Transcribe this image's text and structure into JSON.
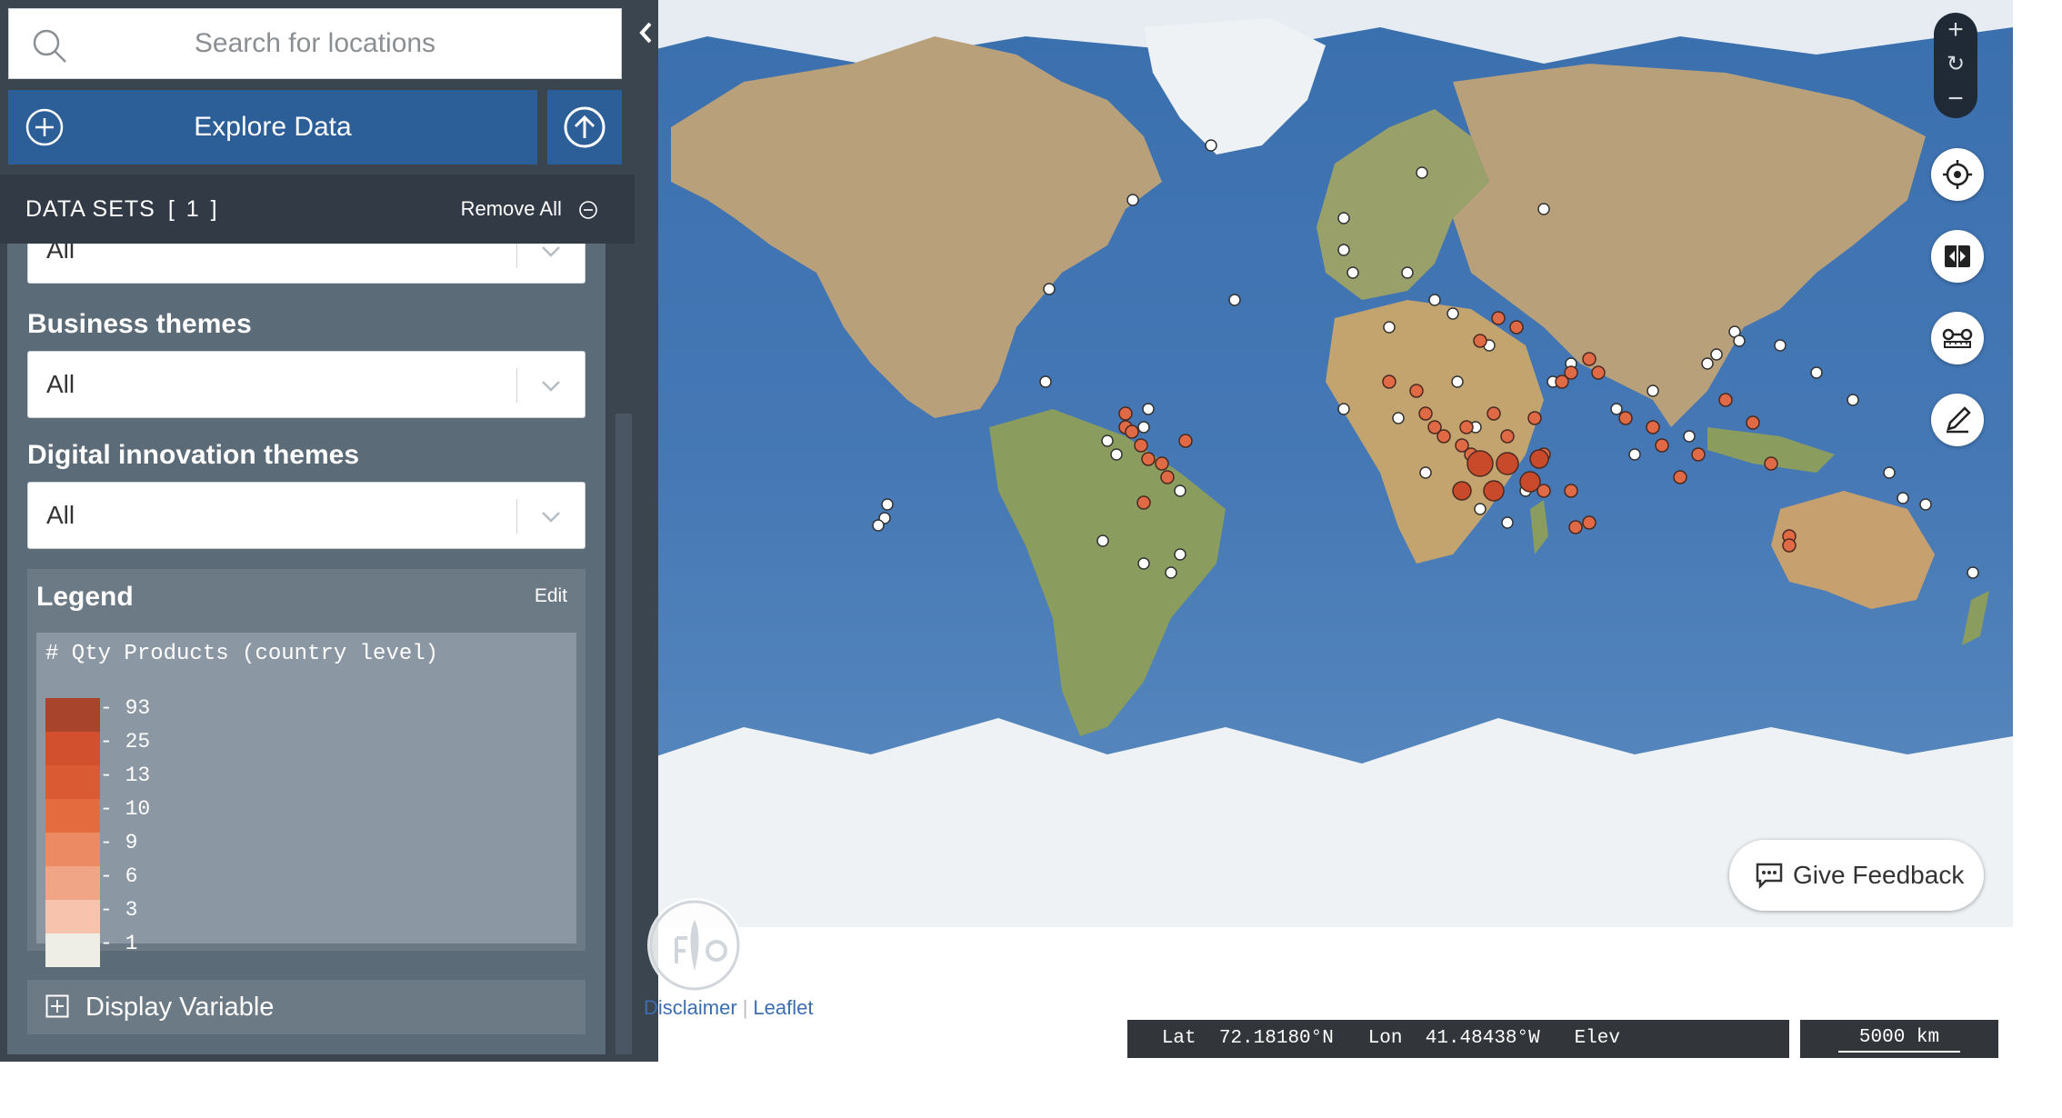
{
  "search": {
    "placeholder": "Search for locations"
  },
  "explore": {
    "label": "Explore Data"
  },
  "datasets": {
    "title": "DATA SETS",
    "count": "[ 1 ]",
    "remove_all": "Remove All"
  },
  "filters": [
    {
      "label": "",
      "value": "All"
    },
    {
      "label": "Business themes",
      "value": "All"
    },
    {
      "label": "Digital innovation themes",
      "value": "All"
    }
  ],
  "legend": {
    "title": "Legend",
    "edit": "Edit",
    "variable": "# Qty Products (country level)",
    "classes": [
      {
        "value": "93",
        "color": "#a8442c"
      },
      {
        "value": "25",
        "color": "#d3502f"
      },
      {
        "value": "13",
        "color": "#d95a33"
      },
      {
        "value": "10",
        "color": "#e36b3e"
      },
      {
        "value": "9",
        "color": "#ec8a64"
      },
      {
        "value": "6",
        "color": "#f0a586"
      },
      {
        "value": "3",
        "color": "#f7c3ad"
      },
      {
        "value": "1",
        "color": "#eeeee6"
      }
    ]
  },
  "display_variable": {
    "label": "Display Variable"
  },
  "map": {
    "zoom_in": "+",
    "zoom_reset": "↻",
    "zoom_out": "−",
    "feedback": "Give Feedback",
    "attribution": {
      "disclaimer": "Disclaimer",
      "leaflet": "Leaflet"
    },
    "coords": {
      "lat_label": "Lat",
      "lat": "72.18180°N",
      "lon_label": "Lon",
      "lon": "41.48438°W",
      "elev_label": "Elev"
    },
    "scale": "5000 km"
  },
  "colors": {
    "ocean": "#3f74b2",
    "land": "#bfa57d",
    "ice": "#eef2f5",
    "sidebar": "#3b4550",
    "accent": "#2c5e97"
  }
}
